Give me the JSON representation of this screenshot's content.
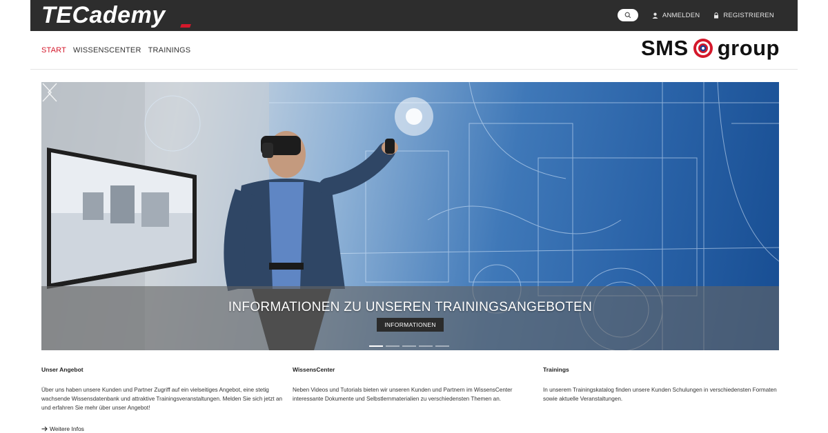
{
  "header": {
    "logo_text": "TECademy",
    "login_label": "ANMELDEN",
    "register_label": "REGISTRIEREN",
    "icons": {
      "search": "search-icon",
      "login": "user-icon",
      "register": "lock-icon"
    }
  },
  "nav": {
    "items": [
      {
        "label": "START",
        "active": true
      },
      {
        "label": "WISSENSCENTER",
        "active": false
      },
      {
        "label": "TRAININGS",
        "active": false
      }
    ]
  },
  "partner_logo": {
    "text_left": "SMS",
    "text_right": "group"
  },
  "hero": {
    "title": "INFORMATIONEN ZU UNSEREN TRAININGSANGEBOTEN",
    "button_label": "INFORMATIONEN",
    "slide_count": 5,
    "active_slide": 1
  },
  "columns": [
    {
      "heading": "Unser Angebot",
      "text": "Über uns haben unsere Kunden und Partner Zugriff auf ein vielseitiges Angebot, eine stetig wachsende Wissensdatenbank und attraktive Trainingsveranstaltungen. Melden Sie sich jetzt an und erfahren Sie mehr über unser Angebot!"
    },
    {
      "heading": "WissensCenter",
      "text": "Neben Videos und Tutorials bieten wir unseren Kunden und Partnern im WissensCenter interessante Dokumente und Selbstlernmaterialien zu verschiedensten Themen an."
    },
    {
      "heading": "Trainings",
      "text": "In unserem Trainingskatalog finden unsere Kunden Schulungen in verschiedensten Formaten sowie aktuelle Veranstaltungen."
    }
  ],
  "more_link": "Weitere Infos",
  "colors": {
    "accent": "#d4182b",
    "topbar": "#2d2d2d"
  }
}
